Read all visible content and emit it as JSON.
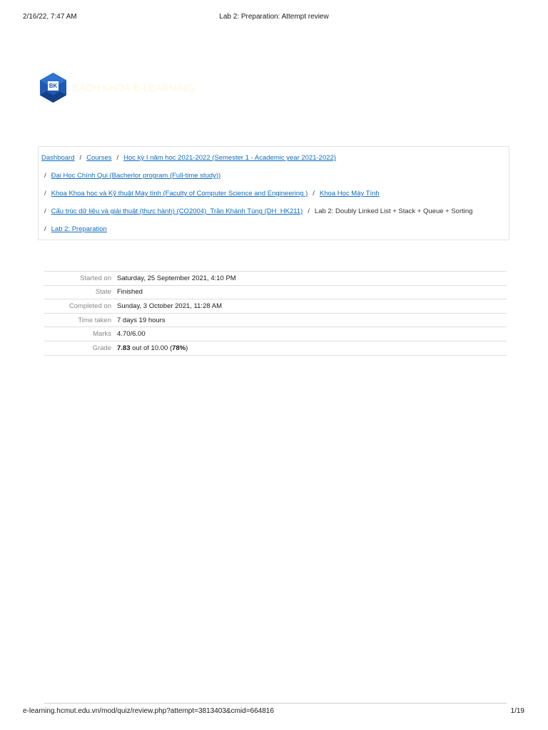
{
  "print_header": {
    "datetime": "2/16/22, 7:47 AM",
    "title": "Lab 2: Preparation: Attempt review"
  },
  "logo": {
    "badge_text": "BK",
    "site_name": "BÁCH KHOA E-LEARNING",
    "colors": {
      "mark": "#1f5bb6",
      "mark_dark": "#153f86",
      "site_name": "#fff6da"
    }
  },
  "breadcrumb": {
    "link_color": "#0f6cbf",
    "separator": "/",
    "items": [
      {
        "label": "Dashboard",
        "link": true
      },
      {
        "label": "Courses",
        "link": true
      },
      {
        "label": "Học kỳ I năm học 2021-2022 (Semester 1 - Academic year 2021-2022)",
        "link": true
      },
      {
        "label": "Đại Học Chính Qui (Bacherlor program (Full-time study))",
        "link": true
      },
      {
        "label": "Khoa Khoa học và Kỹ thuật Máy tính (Faculty of Computer Science and Engineering )",
        "link": true
      },
      {
        "label": "Khoa Học Máy Tính",
        "link": true
      },
      {
        "label": "Cấu trúc dữ liệu và giải thuật (thực hành) (CO2004)_Trần Khánh Tùng (DH_HK211)",
        "link": true
      },
      {
        "label": "Lab 2: Doubly Linked List + Stack + Queue + Sorting",
        "link": false
      },
      {
        "label": "Lab 2: Preparation",
        "link": true
      }
    ]
  },
  "summary": {
    "started_on": {
      "label": "Started on",
      "value": "Saturday, 25 September 2021, 4:10 PM"
    },
    "state": {
      "label": "State",
      "value": "Finished"
    },
    "completed_on": {
      "label": "Completed on",
      "value": "Sunday, 3 October 2021, 11:28 AM"
    },
    "time_taken": {
      "label": "Time taken",
      "value": "7 days 19 hours"
    },
    "marks": {
      "label": "Marks",
      "value": "4.70/6.00"
    },
    "grade": {
      "label": "Grade",
      "score": "7.83",
      "out_of_text": " out of 10.00 (",
      "percent": "78%",
      "close_paren": ")"
    }
  },
  "print_footer": {
    "url": "e-learning.hcmut.edu.vn/mod/quiz/review.php?attempt=3813403&cmid=664816",
    "page": "1/19"
  }
}
